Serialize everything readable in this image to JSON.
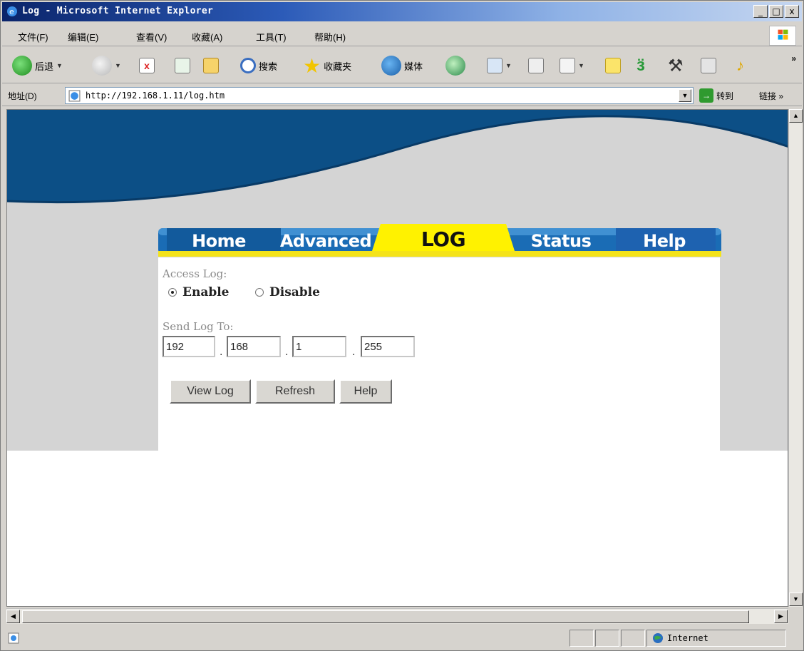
{
  "window": {
    "title": "Log - Microsoft Internet Explorer",
    "controls": [
      "_",
      "□",
      "x"
    ]
  },
  "menubar": {
    "items": [
      "文件(F)",
      "编辑(E)",
      "查看(V)",
      "收藏(A)",
      "工具(T)",
      "帮助(H)"
    ]
  },
  "toolbar": {
    "back": "后退",
    "search": "搜索",
    "favorites": "收藏夹",
    "media": "媒体",
    "more": "»"
  },
  "addressbar": {
    "label": "地址(D)",
    "url": "http://192.168.1.11/log.htm",
    "go": "转到",
    "links": "链接 »"
  },
  "nav": {
    "tabs": [
      "Home",
      "Advanced",
      "LOG",
      "Status",
      "Help"
    ],
    "active": "LOG",
    "colors": {
      "bar": "#1a6cb5",
      "active": "#fff200",
      "accent": "#f4e31a"
    }
  },
  "log": {
    "access_log_label": "Access Log:",
    "enable_label": "Enable",
    "disable_label": "Disable",
    "enabled": true,
    "send_to_label": "Send Log To:",
    "ip": [
      "192",
      "168",
      "1",
      "255"
    ],
    "separator": "."
  },
  "buttons": {
    "view_log": "View Log",
    "refresh": "Refresh",
    "help": "Help"
  },
  "statusbar": {
    "zone": "Internet"
  }
}
